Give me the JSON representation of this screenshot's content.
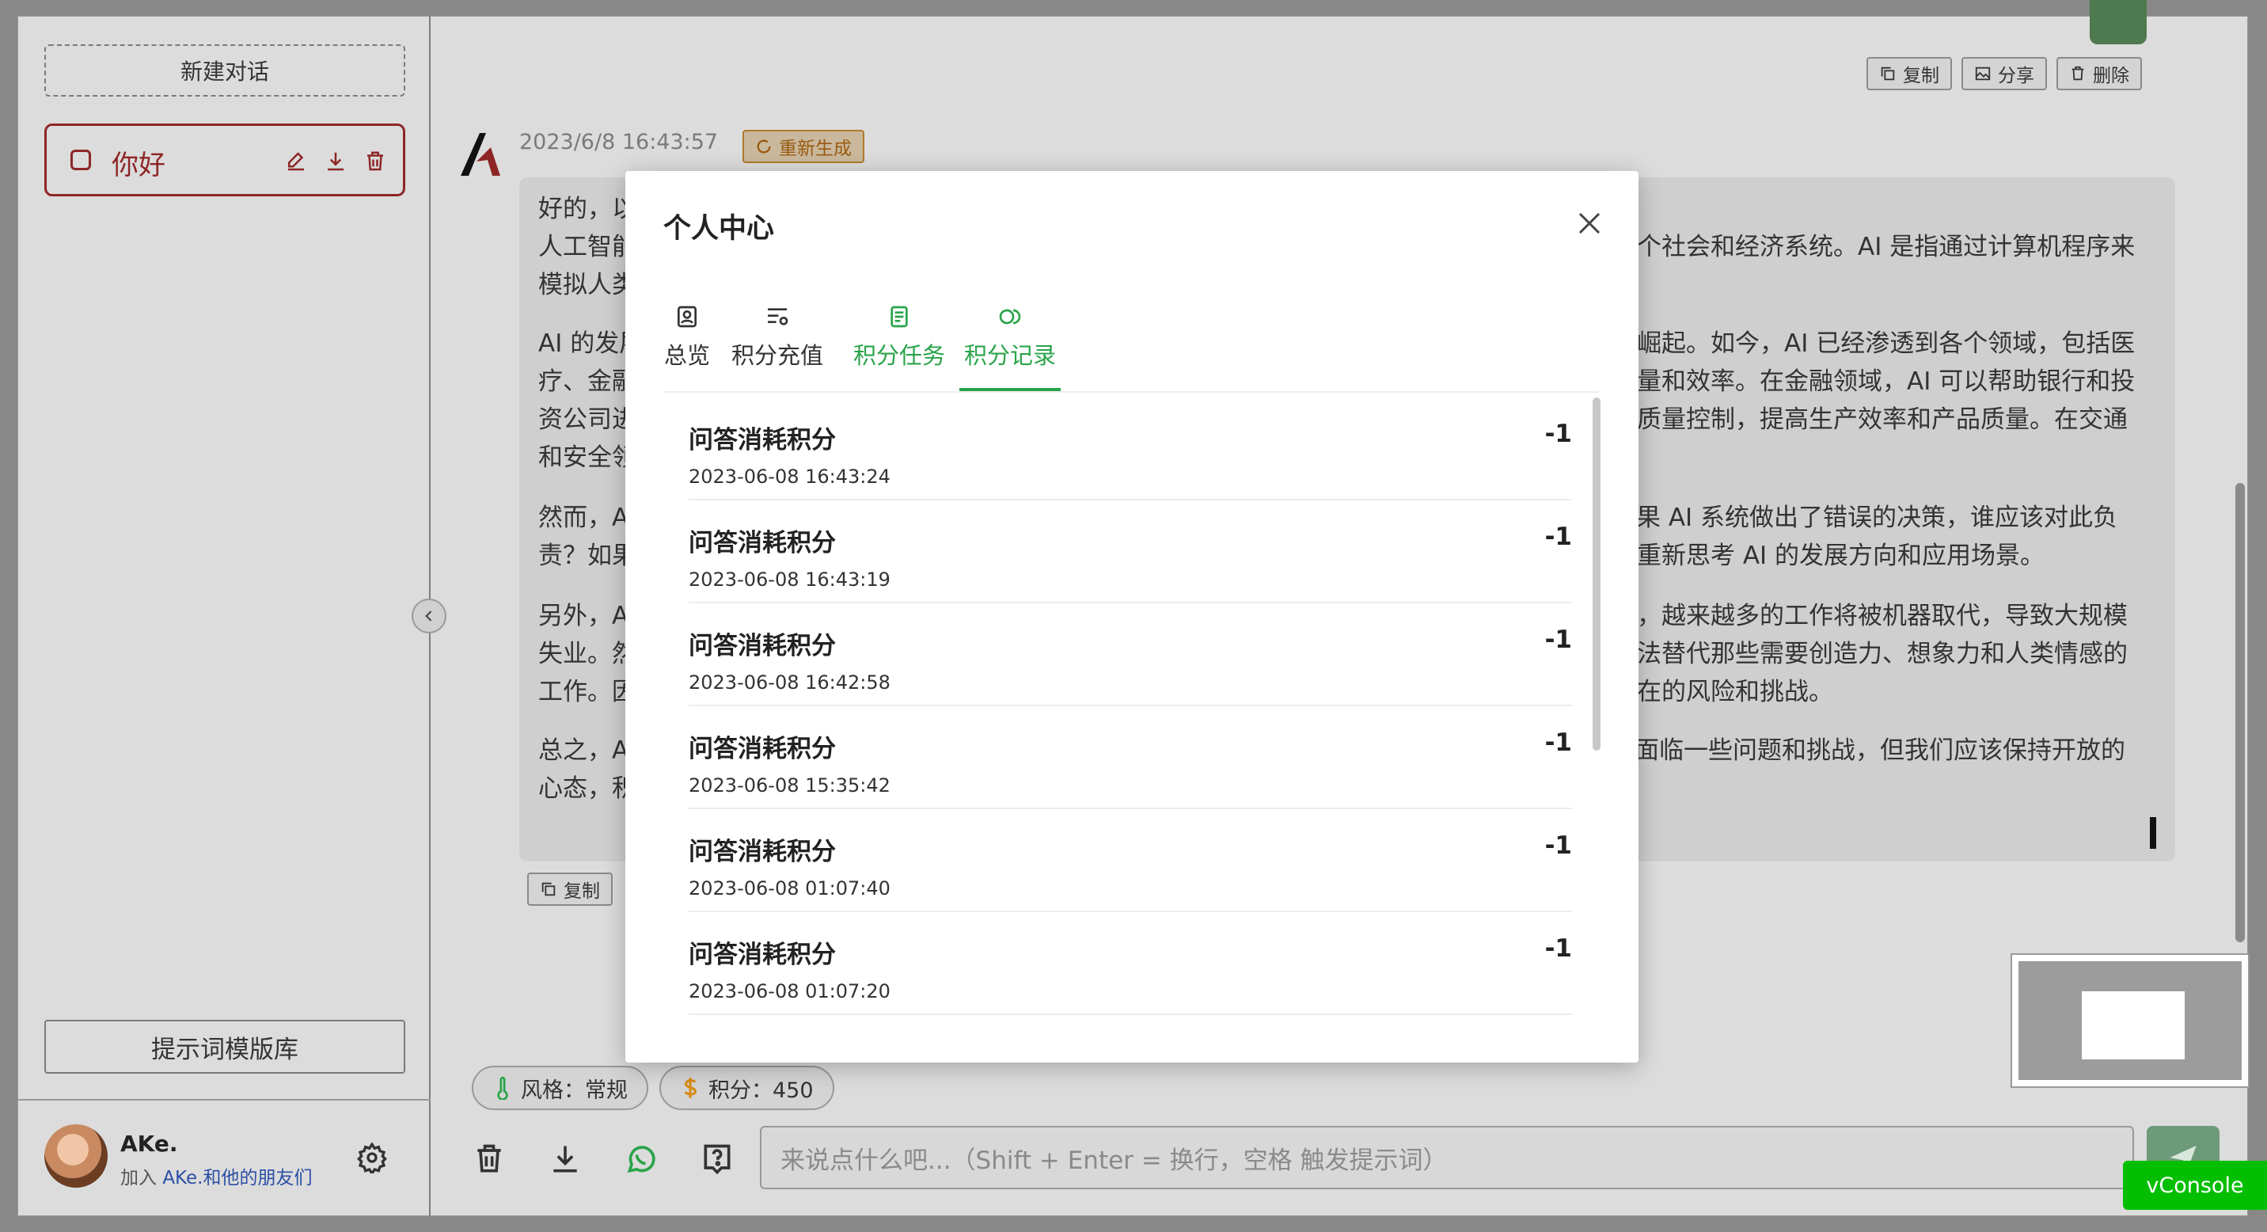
{
  "sidebar": {
    "new_chat": "新建对话",
    "chat_item": "你好",
    "prompt_library": "提示词模版库",
    "user": {
      "name": "AKe.",
      "join_prefix": "加入 ",
      "join_link": "AKe.和他的朋友们"
    }
  },
  "top_actions": {
    "copy": "复制",
    "share": "分享",
    "delete": "删除"
  },
  "message": {
    "timestamp": "2023/6/8 16:43:57",
    "regenerate": "重新生成",
    "paragraphs": [
      [
        "好的，以"
      ],
      [
        "人工智能",
        "个社会和经济系统。AI 是指通过计算机程序来"
      ],
      [
        "模拟人类"
      ],
      [
        "AI 的发展",
        "崛起。如今，AI 已经渗透到各个领域，包括医"
      ],
      [
        "疗、金融",
        "量和效率。在金融领域，AI 可以帮助银行和投"
      ],
      [
        "资公司进",
        "质量控制，提高生产效率和产品质量。在交通"
      ],
      [
        "和安全领"
      ],
      [
        "然而，A",
        "如果 AI 系统做出了错误的决策，谁应该对此负"
      ],
      [
        "责？如果",
        "重新思考 AI 的发展方向和应用场景。"
      ],
      [
        "另外，A",
        "，越来越多的工作将被机器取代，导致大规模"
      ],
      [
        "失业。然",
        "法替代那些需要创造力、想象力和人类情感的"
      ],
      [
        "工作。因",
        "在的风险和挑战。"
      ],
      [
        "总之，A",
        "要面临一些问题和挑战，但我们应该保持开放的"
      ],
      [
        "心态，积"
      ]
    ],
    "copy": "复制"
  },
  "chips": {
    "style": "风格：常规",
    "points": "积分：450"
  },
  "input": {
    "placeholder": "来说点什么吧...（Shift + Enter = 换行，空格 触发提示词）"
  },
  "vconsole": "vConsole",
  "modal": {
    "title": "个人中心",
    "tabs": [
      "总览",
      "积分充值",
      "积分任务",
      "积分记录"
    ],
    "active_tab": "积分记录",
    "records": [
      {
        "title": "问答消耗积分",
        "date": "2023-06-08 16:43:24",
        "points": "-1"
      },
      {
        "title": "问答消耗积分",
        "date": "2023-06-08 16:43:19",
        "points": "-1"
      },
      {
        "title": "问答消耗积分",
        "date": "2023-06-08 16:42:58",
        "points": "-1"
      },
      {
        "title": "问答消耗积分",
        "date": "2023-06-08 15:35:42",
        "points": "-1"
      },
      {
        "title": "问答消耗积分",
        "date": "2023-06-08 01:07:40",
        "points": "-1"
      },
      {
        "title": "问答消耗积分",
        "date": "2023-06-08 01:07:20",
        "points": "-1"
      }
    ]
  },
  "colors": {
    "accent_green": "#2aa44a",
    "chat_item_red": "#8e2626",
    "vconsole_green": "#04be02"
  }
}
